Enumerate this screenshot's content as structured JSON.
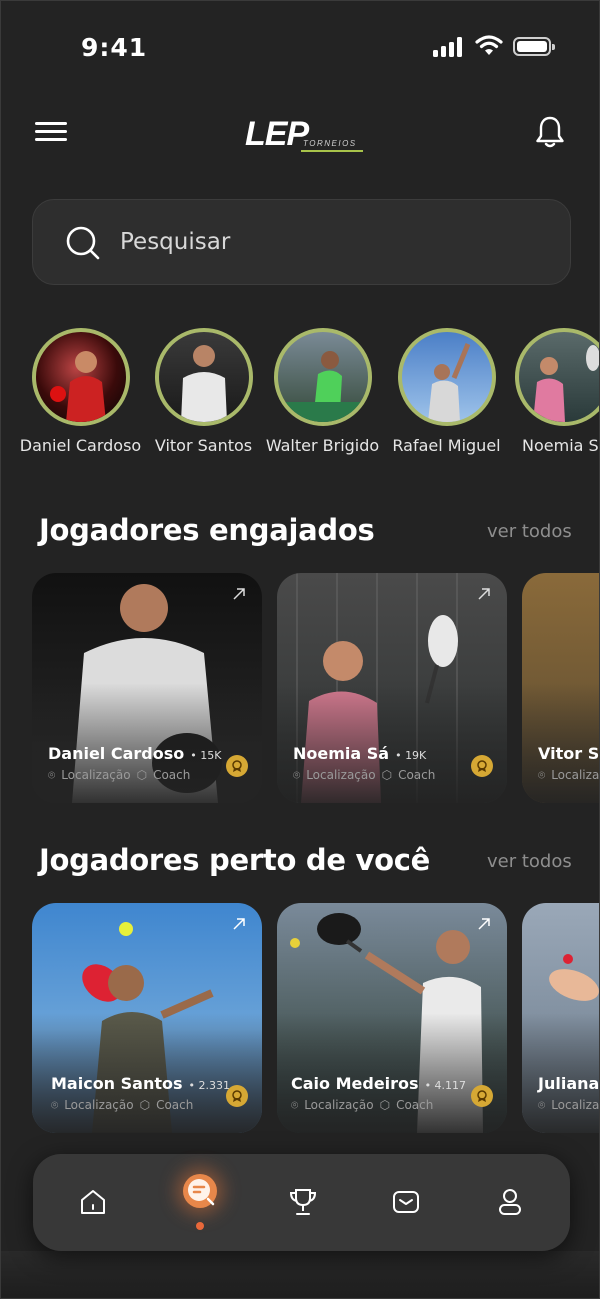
{
  "status_bar": {
    "time": "9:41"
  },
  "header": {
    "logo_main": "LEP",
    "logo_sub": "TORNEIOS"
  },
  "search": {
    "placeholder": "Pesquisar"
  },
  "stories": [
    {
      "name": "Daniel Cardoso"
    },
    {
      "name": "Vitor Santos"
    },
    {
      "name": "Walter Brigido"
    },
    {
      "name": "Rafael Miguel"
    },
    {
      "name": "Noemia Sá"
    }
  ],
  "engaged": {
    "title": "Jogadores engajados",
    "see_all": "ver todos",
    "cards": [
      {
        "name": "Daniel  Cardoso",
        "count": "• 15K",
        "location": "Localização",
        "role": "Coach"
      },
      {
        "name": "Noemia Sá",
        "count": "• 19K",
        "location": "Localização",
        "role": "Coach"
      },
      {
        "name": "Vitor Sar",
        "count": "",
        "location": "Localizaç",
        "role": ""
      }
    ]
  },
  "nearby": {
    "title": "Jogadores perto de você",
    "see_all": "ver todos",
    "cards": [
      {
        "name": "Maicon Santos",
        "count": "• 2.331",
        "location": "Localização",
        "role": "Coach"
      },
      {
        "name": "Caio Medeiros",
        "count": "• 4.117",
        "location": "Localização",
        "role": "Coach"
      },
      {
        "name": "Juliana F",
        "count": "",
        "location": "Localiza",
        "role": ""
      }
    ]
  },
  "nav": {
    "items": [
      "home-icon",
      "feed-search-icon",
      "trophy-icon",
      "inbox-icon",
      "profile-icon"
    ],
    "active": "feed-search-icon"
  },
  "colors": {
    "accent": "#a9b96a",
    "nav_active": "#e8874a",
    "badge": "#d6a834",
    "background": "#232323"
  }
}
